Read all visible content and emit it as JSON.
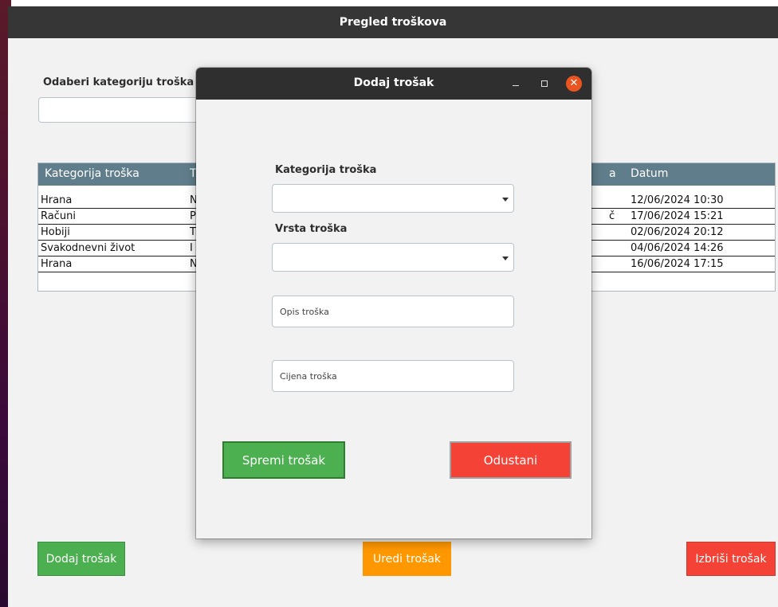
{
  "main": {
    "title": "Pregled troškova",
    "category_filter_label": "Odaberi kategoriju troška",
    "table": {
      "headers": {
        "category": "Kategorija troška",
        "type": "T",
        "desc": "a",
        "date": "Datum"
      },
      "rows": [
        {
          "category": "Hrana",
          "type": "N",
          "desc": "",
          "date": "12/06/2024 10:30"
        },
        {
          "category": "Računi",
          "type": "P",
          "desc": "č",
          "date": "17/06/2024 15:21"
        },
        {
          "category": "Hobiji",
          "type": "T",
          "desc": "",
          "date": "02/06/2024 20:12"
        },
        {
          "category": "Svakodnevni život",
          "type": "I",
          "desc": "",
          "date": "04/06/2024 14:26"
        },
        {
          "category": "Hrana",
          "type": "N",
          "desc": "",
          "date": "16/06/2024 17:15"
        }
      ]
    },
    "buttons": {
      "add": "Dodaj trošak",
      "edit": "Uredi trošak",
      "delete": "Izbriši trošak"
    }
  },
  "dialog": {
    "title": "Dodaj trošak",
    "controls": {
      "minimize": "–",
      "close": "✕"
    },
    "category_label": "Kategorija troška",
    "type_label": "Vrsta troška",
    "description_placeholder": "Opis troška",
    "price_placeholder": "Cijena troška",
    "save_label": "Spremi trošak",
    "cancel_label": "Odustani"
  },
  "colors": {
    "header_bg": "#607d8b",
    "green": "#4caf50",
    "orange": "#ff9800",
    "red": "#f44336",
    "titlebar": "#363636",
    "close_button": "#e95420"
  }
}
